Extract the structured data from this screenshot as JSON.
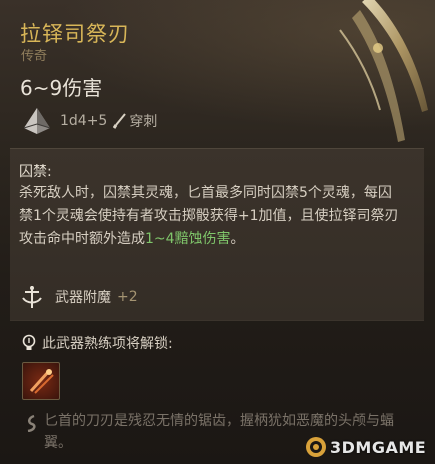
{
  "item": {
    "name": "拉铎司祭刃",
    "rarity": "传奇",
    "damage": "6~9伤害",
    "dice": "1d4+5",
    "damage_type": "穿刺"
  },
  "passive": {
    "title": "囚禁:",
    "text_1": "杀死敌人时，囚禁其灵魂，匕首最多同时囚禁5个灵魂，每囚禁1个灵魂会使持有者攻击掷骰获得+1加值，且使拉铎司祭刃攻击命中时额外造成",
    "highlight": "1~4黯蚀伤害",
    "text_2": "。",
    "highlight_color": "#7fc56a"
  },
  "enchant": {
    "label": "武器附魔",
    "value": "+2"
  },
  "mastery": {
    "text": "此武器熟练项将解锁:"
  },
  "flavor": {
    "text": "匕首的刀刃是残忍无情的锯齿，握柄犹如恶魔的头颅与蝠翼。"
  },
  "watermark": {
    "text": "3DMGAME"
  },
  "colors": {
    "title": "#d8b658",
    "body_text": "#d7cfc2",
    "muted": "#7a7268"
  },
  "icons": [
    "dagger-image",
    "dice-icon",
    "pierce-icon",
    "enchant-icon",
    "lightbulb-icon",
    "skill-icon",
    "quote-icon",
    "watermark-logo"
  ]
}
